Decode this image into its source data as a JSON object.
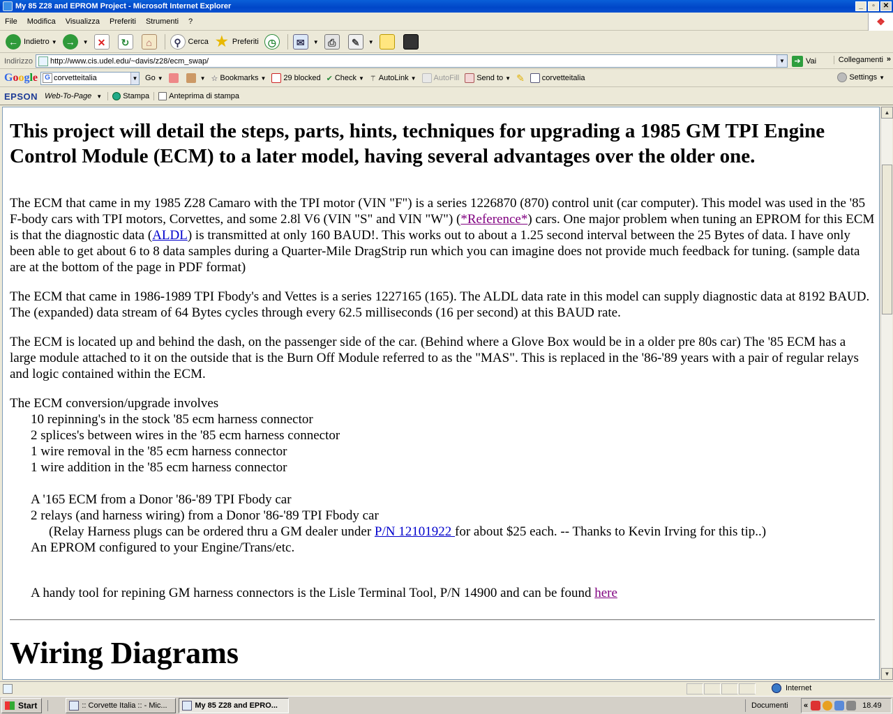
{
  "window": {
    "title": "My 85 Z28 and EPROM Project - Microsoft Internet Explorer"
  },
  "menu": [
    "File",
    "Modifica",
    "Visualizza",
    "Preferiti",
    "Strumenti",
    "?"
  ],
  "toolbar": {
    "back_label": "Indietro",
    "search_label": "Cerca",
    "favorites_label": "Preferiti"
  },
  "address": {
    "label": "Indirizzo",
    "url": "http://www.cis.udel.edu/~davis/z28/ecm_swap/",
    "go_label": "Vai",
    "links_label": "Collegamenti"
  },
  "google_toolbar": {
    "logo": "Google",
    "search_value": "corvetteitalia",
    "go_label": "Go",
    "bookmarks_label": "Bookmarks",
    "blocked_label": "29 blocked",
    "check_label": "Check",
    "autolink_label": "AutoLink",
    "autofill_label": "AutoFill",
    "sendto_label": "Send to",
    "highlight_label": "corvetteitalia",
    "settings_label": "Settings"
  },
  "epson_toolbar": {
    "logo": "EPSON",
    "web_to_page": "Web-To-Page",
    "print_label": "Stampa",
    "preview_label": "Anteprima di stampa"
  },
  "page": {
    "heading": "This project will detail the steps, parts, hints, techniques for upgrading a 1985 GM TPI Engine Control Module (ECM) to a later model, having several advantages over the older one.",
    "p1_a": "The ECM that came in my 1985 Z28 Camaro with the TPI motor (VIN \"F\") is a series 1226870 (870) control unit (car computer). This model was used in the '85 F-body cars with TPI motors, Corvettes, and some 2.8l V6 (VIN \"S\" and VIN \"W\") (",
    "p1_link1": "*Reference*",
    "p1_b": ") cars. One major problem when tuning an EPROM for this ECM is that the diagnostic data (",
    "p1_link2": "ALDL",
    "p1_c": ") is transmitted at only 160 BAUD!. This works out to about a 1.25 second interval between the 25 Bytes of data. I have only been able to get about 6 to 8 data samples during a Quarter-Mile DragStrip run which you can imagine does not provide much feedback for tuning. (sample data are at the bottom of the page in PDF format)",
    "p2": "The ECM that came in 1986-1989 TPI Fbody's and Vettes is a series 1227165 (165). The ALDL data rate in this model can supply diagnostic data at 8192 BAUD. The (expanded) data stream of 64 Bytes cycles through every 62.5 milliseconds (16 per second) at this BAUD rate.",
    "p3": "The ECM is located up and behind the dash, on the passenger side of the car. (Behind where a Glove Box would be in a older pre 80s car) The '85 ECM has a large module attached to it on the outside that is the Burn Off Module referred to as the \"MAS\". This is replaced in the '86-'89 years with a pair of regular relays and logic contained within the ECM.",
    "conv_intro": "The ECM conversion/upgrade involves",
    "conv_items": [
      "10 repinning's in the stock '85 ecm harness connector",
      "2 splices's between wires in the '85 ecm harness connector",
      "1 wire removal in the '85 ecm harness connector",
      "1 wire addition in the '85 ecm harness connector"
    ],
    "parts_1": "A '165 ECM from a Donor '86-'89 TPI Fbody car",
    "parts_2": "2 relays (and harness wiring) from a Donor '86-'89 TPI Fbody car",
    "relay_a": "(Relay Harness plugs can be ordered thru a GM dealer under ",
    "relay_link": "P/N 12101922 ",
    "relay_b": "for about $25 each. -- Thanks to Kevin Irving for this tip..)",
    "parts_3": "An EPROM configured to your Engine/Trans/etc.",
    "tool_a": "A handy tool for repining GM harness connectors is the Lisle Terminal Tool, P/N 14900 and can be found ",
    "tool_link": "here",
    "next_heading": "Wiring Diagrams"
  },
  "status": {
    "zone": "Internet"
  },
  "taskbar": {
    "start": "Start",
    "task1": ":: Corvette Italia :: - Mic...",
    "task2": "My 85 Z28 and EPRO...",
    "docs": "Documenti",
    "clock": "18.49"
  }
}
